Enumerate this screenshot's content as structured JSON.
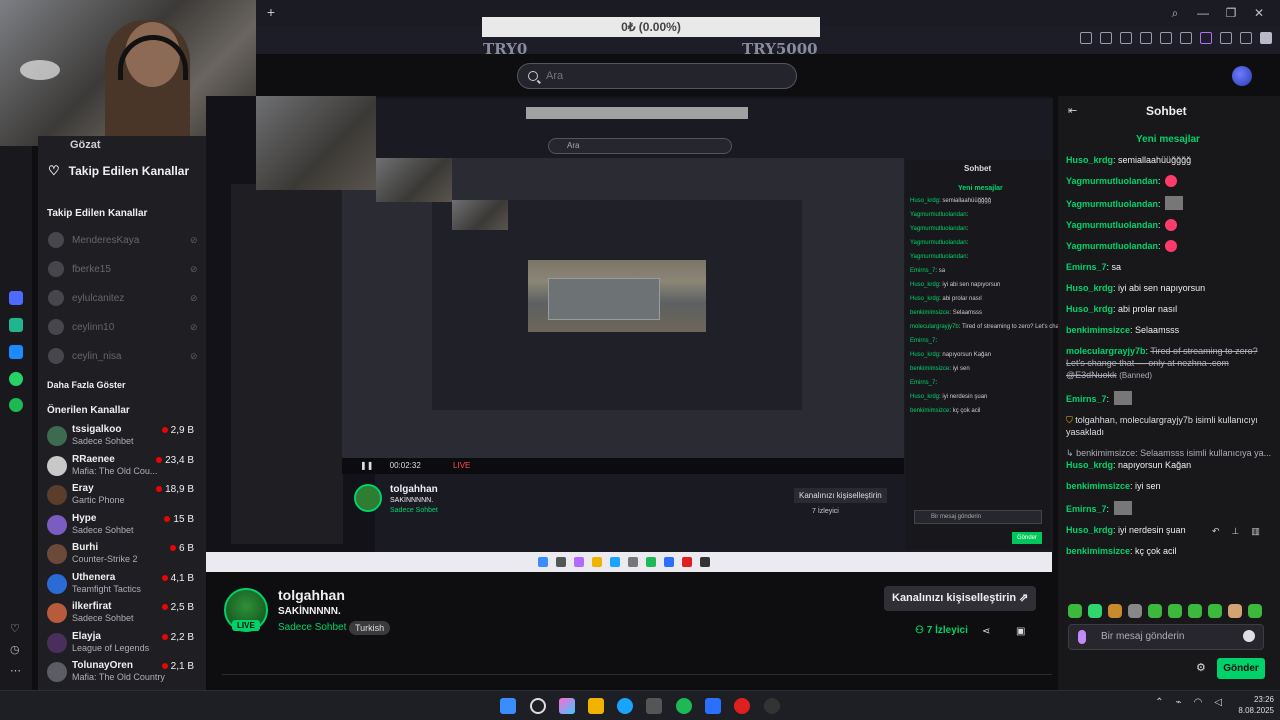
{
  "donation": {
    "text": "0₺ (0.00%)",
    "progress_percent": 0,
    "min_label": "TRY0",
    "max_label": "TRY5000"
  },
  "search": {
    "placeholder": "Ara"
  },
  "sidebar": {
    "browse_label": "Gözat",
    "followed_header": "Takip Edilen Kanallar",
    "followed_section_title": "Takip Edilen Kanallar",
    "offline_channels": [
      "MenderesKaya",
      "fberke15",
      "eylulcanitez",
      "ceylinn10",
      "ceylin_nisa"
    ],
    "show_more": "Daha Fazla Göster",
    "recommended_title": "Önerilen Kanallar",
    "recommended": [
      {
        "name": "tssigalkoo",
        "game": "Sadece Sohbet",
        "viewers": "2,9 B"
      },
      {
        "name": "RRaenee",
        "game": "Mafia: The Old Cou...",
        "viewers": "23,4 B"
      },
      {
        "name": "Eray",
        "game": "Gartic Phone",
        "viewers": "18,9 B"
      },
      {
        "name": "Hype",
        "game": "Sadece Sohbet",
        "viewers": "15 B"
      },
      {
        "name": "Burhi",
        "game": "Counter-Strike 2",
        "viewers": "6 B"
      },
      {
        "name": "Uthenera",
        "game": "Teamfight Tactics",
        "viewers": "4,1 B"
      },
      {
        "name": "ilkerfirat",
        "game": "Sadece Sohbet",
        "viewers": "2,5 B"
      },
      {
        "name": "Elayja",
        "game": "League of Legends",
        "viewers": "2,2 B"
      },
      {
        "name": "TolunayOren",
        "game": "Mafia: The Old Country",
        "viewers": "2,1 B"
      }
    ]
  },
  "channel": {
    "name": "tolgahhan",
    "title": "SAKİNNNNN.",
    "category": "Sadece Sohbet",
    "tag": "Turkish",
    "live_badge": "LIVE",
    "customize_label": "Kanalınızı kişiselleştirin",
    "viewers": "7 İzleyici"
  },
  "nested": {
    "search_placeholder": "Ara",
    "player_time": "00:02:32",
    "player_live": "LIVE",
    "chat_title": "Sohbet",
    "new_messages": "Yeni mesajlar",
    "input_placeholder": "Bir mesaj gönderin",
    "send": "Gönder",
    "channel_name": "tolgahhan",
    "channel_title": "SAKİNNNNN.",
    "channel_category": "Sadece Sohbet",
    "customize_label": "Kanalınızı kişiselleştirin",
    "viewers": "7 İzleyici"
  },
  "chat": {
    "title": "Sohbet",
    "new_messages": "Yeni mesajlar",
    "messages": [
      {
        "user": "Huso_krdg",
        "text": "semiallaahüüğğğğ"
      },
      {
        "user": "Yagmurmutluolandan",
        "text": "",
        "emote": "red"
      },
      {
        "user": "Yagmurmutluolandan",
        "text": "",
        "emote": "image"
      },
      {
        "user": "Yagmurmutluolandan",
        "text": "",
        "emote": "red"
      },
      {
        "user": "Yagmurmutluolandan",
        "text": "",
        "emote": "red"
      },
      {
        "user": "Emirns_7",
        "text": "sa"
      },
      {
        "user": "Huso_krdg",
        "text": "iyi abi sen napıyorsun"
      },
      {
        "user": "Huso_krdg",
        "text": "abi prolar nasıl"
      },
      {
        "user": "benkimimsizce",
        "text": "Selaamsss"
      },
      {
        "user": "moleculargrayjy7b",
        "text": "Tired of streaming to zero? Let's change that — only at nezhna .com @E3dNuokk",
        "banned": "(Banned)"
      },
      {
        "user": "Emirns_7",
        "text": "",
        "emote": "image"
      }
    ],
    "mod_notice": "tolgahhan, moleculargrayjy7b isimli kullanıcıyı yasakladı",
    "reply_notice": "benkimimsizce: Selaamsss isimli kullanıcıya ya...",
    "messages2": [
      {
        "user": "Huso_krdg",
        "text": "napıyorsun Kağan"
      },
      {
        "user": "benkimimsizce",
        "text": "iyi sen"
      },
      {
        "user": "Emirns_7",
        "text": "",
        "emote": "image"
      },
      {
        "user": "Huso_krdg",
        "text": "iyi nerdesin şuan"
      },
      {
        "user": "benkimimsizce",
        "text": "kç çok acil"
      }
    ],
    "input_placeholder": "Bir mesaj gönderin",
    "send_label": "Gönder"
  },
  "clock": {
    "time": "23:26",
    "date": "8.08.2025"
  },
  "colors": {
    "accent": "#00d26a",
    "brand": "#9147ff",
    "live": "#eb0400"
  }
}
